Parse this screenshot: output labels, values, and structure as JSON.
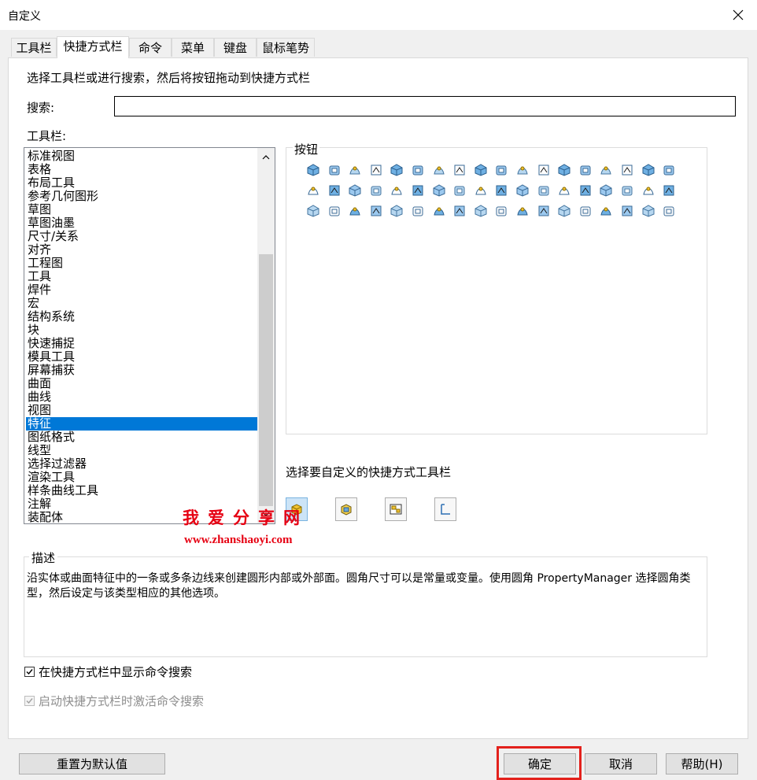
{
  "window": {
    "title": "自定义"
  },
  "tabs": [
    {
      "label": "工具栏"
    },
    {
      "label": "快捷方式栏"
    },
    {
      "label": "命令"
    },
    {
      "label": "菜单"
    },
    {
      "label": "键盘"
    },
    {
      "label": "鼠标笔势"
    }
  ],
  "active_tab_index": 1,
  "instruction": "选择工具栏或进行搜索，然后将按钮拖动到快捷方式栏",
  "search": {
    "label": "搜索:",
    "value": ""
  },
  "toolbars": {
    "label": "工具栏:",
    "items": [
      "标准视图",
      "表格",
      "布局工具",
      "参考几何图形",
      "草图",
      "草图油墨",
      "尺寸/关系",
      "对齐",
      "工程图",
      "工具",
      "焊件",
      "宏",
      "结构系统",
      "块",
      "快速捕捉",
      "模具工具",
      "屏幕捕获",
      "曲面",
      "曲线",
      "视图",
      "特征",
      "图纸格式",
      "线型",
      "选择过滤器",
      "渲染工具",
      "样条曲线工具",
      "注解",
      "装配体"
    ],
    "selected": "特征"
  },
  "buttons_panel": {
    "label": "按钮",
    "icon_count": 54
  },
  "qat": {
    "label": "选择要自定义的快捷方式工具栏",
    "buttons": [
      "part-qat-icon",
      "assembly-qat-icon",
      "drawing-qat-icon",
      "sketch-qat-icon"
    ]
  },
  "watermark": {
    "title": "我爱分享网",
    "url": "www.zhanshaoyi.com"
  },
  "description": {
    "label": "描述",
    "text": "沿实体或曲面特征中的一条或多条边线来创建圆形内部或外部面。圆角尺寸可以是常量或变量。使用圆角 PropertyManager 选择圆角类型，然后设定与该类型相应的其他选项。"
  },
  "options": {
    "show_search": {
      "label": "在快捷方式栏中显示命令搜索",
      "checked": true
    },
    "activate_search": {
      "label": "启动快捷方式栏时激活命令搜索",
      "checked": true,
      "disabled": true
    }
  },
  "footer": {
    "reset": "重置为默认值",
    "ok": "确定",
    "cancel": "取消",
    "help": "帮助(H)"
  },
  "colors": {
    "selection": "#0078d7",
    "highlight_box": "#e3211c",
    "watermark": "#e60012"
  }
}
